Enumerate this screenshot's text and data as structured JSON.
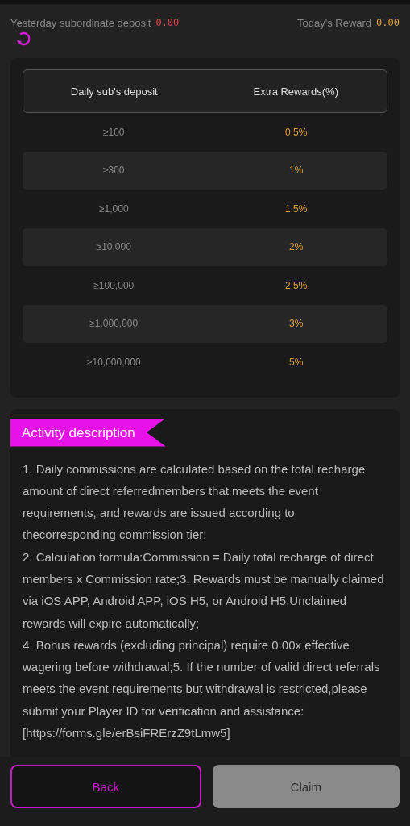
{
  "summary": {
    "deposit_label": "Yesterday subordinate deposit",
    "deposit_value": "0.00",
    "reward_label": "Today's Reward",
    "reward_value": "0.00"
  },
  "table": {
    "columns": [
      "Daily sub's deposit",
      "Extra Rewards(%)"
    ],
    "rows": [
      {
        "deposit": "≥100",
        "reward": "0.5%"
      },
      {
        "deposit": "≥300",
        "reward": "1%"
      },
      {
        "deposit": "≥1,000",
        "reward": "1.5%"
      },
      {
        "deposit": "≥10,000",
        "reward": "2%"
      },
      {
        "deposit": "≥100,000",
        "reward": "2.5%"
      },
      {
        "deposit": "≥1,000,000",
        "reward": "3%"
      },
      {
        "deposit": "≥10,000,000",
        "reward": "5%"
      }
    ]
  },
  "description": {
    "title": "Activity description",
    "paragraphs": [
      "1. Daily commissions are calculated based on the total recharge amount of direct referredmembers that meets the event requirements, and rewards are issued according to thecorresponding commission tier;",
      "2. Calculation formula:Commission = Daily total recharge of direct members x Commission rate;3. Rewards must be manually claimed via iOS APP, Android APP, iOS H5, or Android H5.Unclaimed rewards will expire automatically;",
      "4. Bonus rewards (excluding principal) require 0.00x effective wagering before withdrawal;5. If the number of valid direct referrals meets the event requirements but withdrawal is restricted,please submit your Player ID for verification and assistance: [https://forms.gle/erBsiFRErzZ9tLmw5]"
    ]
  },
  "buttons": [
    {
      "label": "Back",
      "disabled": false
    },
    {
      "label": "Claim",
      "disabled": true
    }
  ]
}
